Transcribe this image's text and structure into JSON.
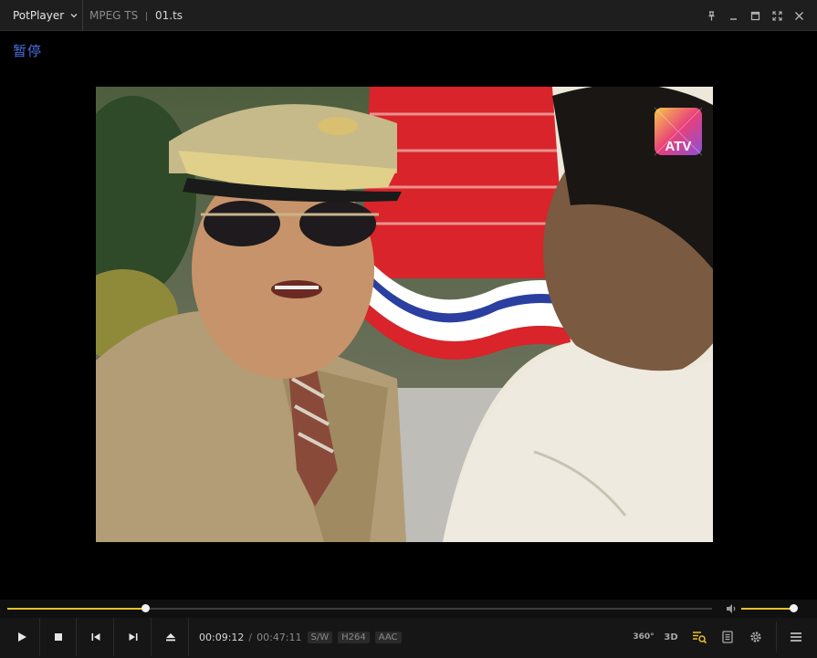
{
  "titlebar": {
    "app_name": "PotPlayer",
    "format": "MPEG TS",
    "filename": "01.ts"
  },
  "osd": {
    "status_text": "暂停"
  },
  "video": {
    "watermark": "ATV"
  },
  "playback": {
    "position": "00:09:12",
    "duration": "00:47:11",
    "progress_fraction": 0.195,
    "volume_fraction": 0.99
  },
  "info_tags": {
    "decoder": "S/W",
    "video_codec": "H264",
    "audio_codec": "AAC"
  },
  "toolbar": {
    "vr_label": "360°",
    "three_d_label": "3D"
  },
  "colors": {
    "accent": "#e8c12a",
    "osd_text": "#4a6fe0",
    "background": "#000000",
    "titlebar": "#1e1e1e"
  }
}
